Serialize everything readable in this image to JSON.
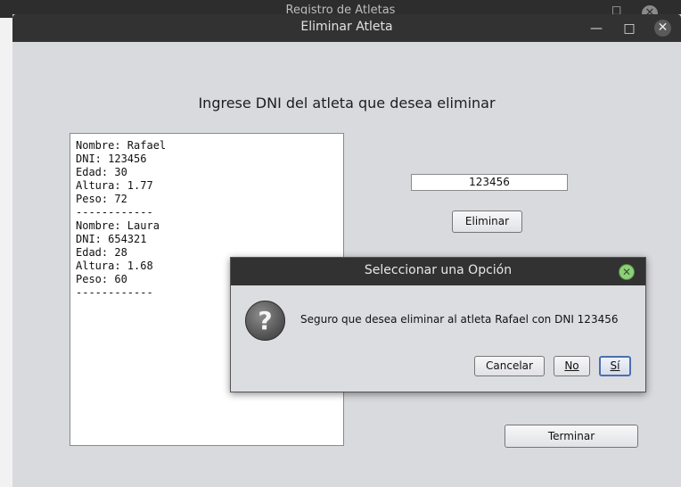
{
  "background_window": {
    "title": "Registro de Atletas"
  },
  "window": {
    "title": "Eliminar Atleta",
    "minimize_glyph": "—",
    "maximize_glyph": "□",
    "close_glyph": "✕"
  },
  "form": {
    "heading": "Ingrese DNI del atleta que desea eliminar",
    "athletes_list": [
      "Nombre: Rafael",
      "DNI: 123456",
      "Edad: 30",
      "Altura: 1.77",
      "Peso: 72",
      "------------",
      "Nombre: Laura",
      "DNI: 654321",
      "Edad: 28",
      "Altura: 1.68",
      "Peso: 60",
      "------------"
    ],
    "dni_input_value": "123456",
    "eliminar_label": "Eliminar",
    "terminar_label": "Terminar"
  },
  "dialog": {
    "title": "Seleccionar una Opción",
    "message": "Seguro que desea eliminar al atleta Rafael con DNI 123456",
    "icon": "question-icon",
    "buttons": {
      "cancel": "Cancelar",
      "no": "No",
      "yes": "Sí"
    },
    "colors": {
      "close_button": "#8ed07a"
    }
  }
}
